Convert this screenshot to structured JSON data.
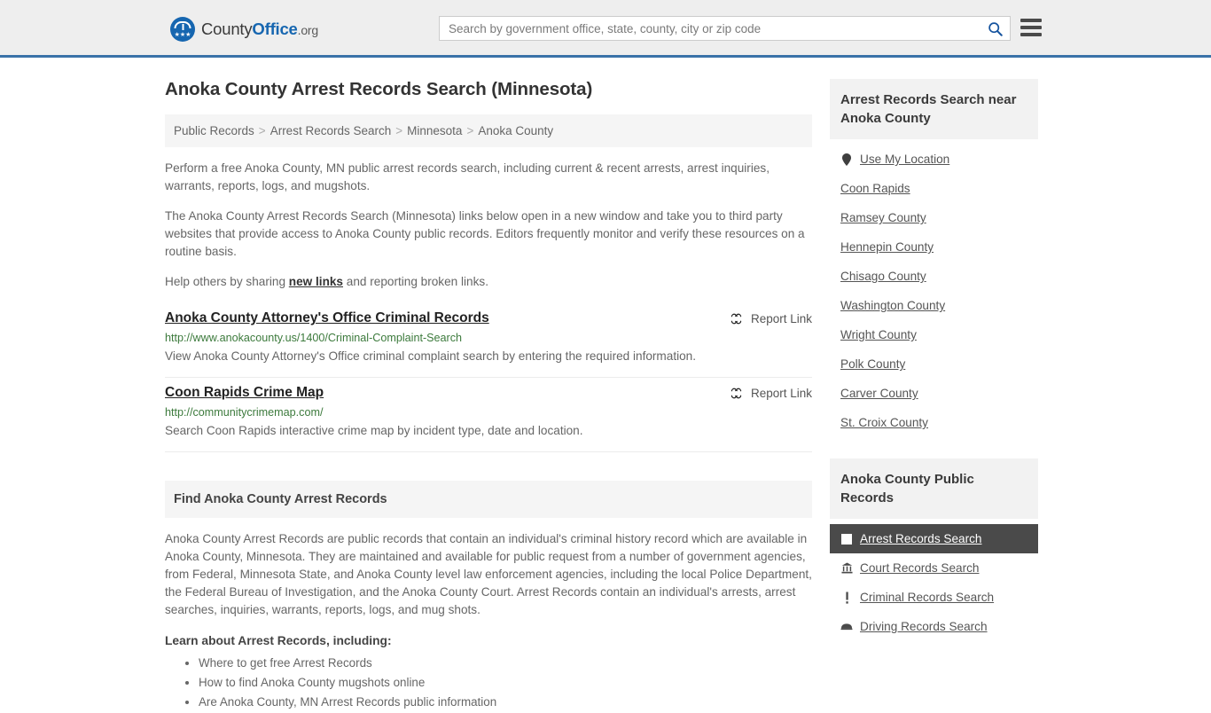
{
  "header": {
    "brand_prefix": "County",
    "brand_bold": "Office",
    "brand_tld": ".org",
    "search_placeholder": "Search by government office, state, county, city or zip code",
    "search_value": "",
    "search_icon": "search-icon",
    "menu_icon": "hamburger-menu-icon",
    "accent_color": "#3a72a8",
    "brand_blue": "#1666b0"
  },
  "main": {
    "title": "Anoka County Arrest Records Search (Minnesota)",
    "breadcrumb": [
      "Public Records",
      "Arrest Records Search",
      "Minnesota",
      "Anoka County"
    ],
    "breadcrumb_separator": ">",
    "intro_1": "Perform a free Anoka County, MN public arrest records search, including current & recent arrests, arrest inquiries, warrants, reports, logs, and mugshots.",
    "intro_2": "The Anoka County Arrest Records Search (Minnesota) links below open in a new window and take you to third party websites that provide access to Anoka County public records. Editors frequently monitor and verify these resources on a routine basis.",
    "intro_3_before": "Help others by sharing ",
    "intro_3_link": "new links",
    "intro_3_after": " and reporting broken links.",
    "report_label": "Report Link",
    "report_icon": "broken-link-icon",
    "url_color": "#3c7a3c",
    "results": [
      {
        "title": "Anoka County Attorney's Office Criminal Records",
        "url": "http://www.anokacounty.us/1400/Criminal-Complaint-Search",
        "description": "View Anoka County Attorney's Office criminal complaint search by entering the required information."
      },
      {
        "title": "Coon Rapids Crime Map",
        "url": "http://communitycrimemap.com/",
        "description": "Search Coon Rapids interactive crime map by incident type, date and location."
      }
    ],
    "section": {
      "heading": "Find Anoka County Arrest Records",
      "body": "Anoka County Arrest Records are public records that contain an individual's criminal history record which are available in Anoka County, Minnesota. They are maintained and available for public request from a number of government agencies, from Federal, Minnesota State, and Anoka County level law enforcement agencies, including the local Police Department, the Federal Bureau of Investigation, and the Anoka County Court. Arrest Records contain an individual's arrests, arrest searches, inquiries, warrants, reports, logs, and mug shots.",
      "sub_heading": "Learn about Arrest Records, including:",
      "bullets": [
        "Where to get free Arrest Records",
        "How to find Anoka County mugshots online",
        "Are Anoka County, MN Arrest Records public information"
      ]
    }
  },
  "sidebar": {
    "near": {
      "heading": "Arrest Records Search near Anoka County",
      "items": [
        {
          "label": "Use My Location",
          "icon": "map-pin-icon"
        },
        {
          "label": "Coon Rapids",
          "icon": ""
        },
        {
          "label": "Ramsey County",
          "icon": ""
        },
        {
          "label": "Hennepin County",
          "icon": ""
        },
        {
          "label": "Chisago County",
          "icon": ""
        },
        {
          "label": "Washington County",
          "icon": ""
        },
        {
          "label": "Wright County",
          "icon": ""
        },
        {
          "label": "Polk County",
          "icon": ""
        },
        {
          "label": "Carver County",
          "icon": ""
        },
        {
          "label": "St. Croix County",
          "icon": ""
        }
      ]
    },
    "public_records": {
      "heading": "Anoka County Public Records",
      "items": [
        {
          "label": "Arrest Records Search",
          "icon": "handcuffs-square-icon",
          "active": true
        },
        {
          "label": "Court Records Search",
          "icon": "courthouse-icon",
          "active": false
        },
        {
          "label": "Criminal Records Search",
          "icon": "exclamation-icon",
          "active": false
        },
        {
          "label": "Driving Records Search",
          "icon": "car-icon",
          "active": false
        }
      ],
      "active_bg": "#4a4a4a"
    }
  }
}
